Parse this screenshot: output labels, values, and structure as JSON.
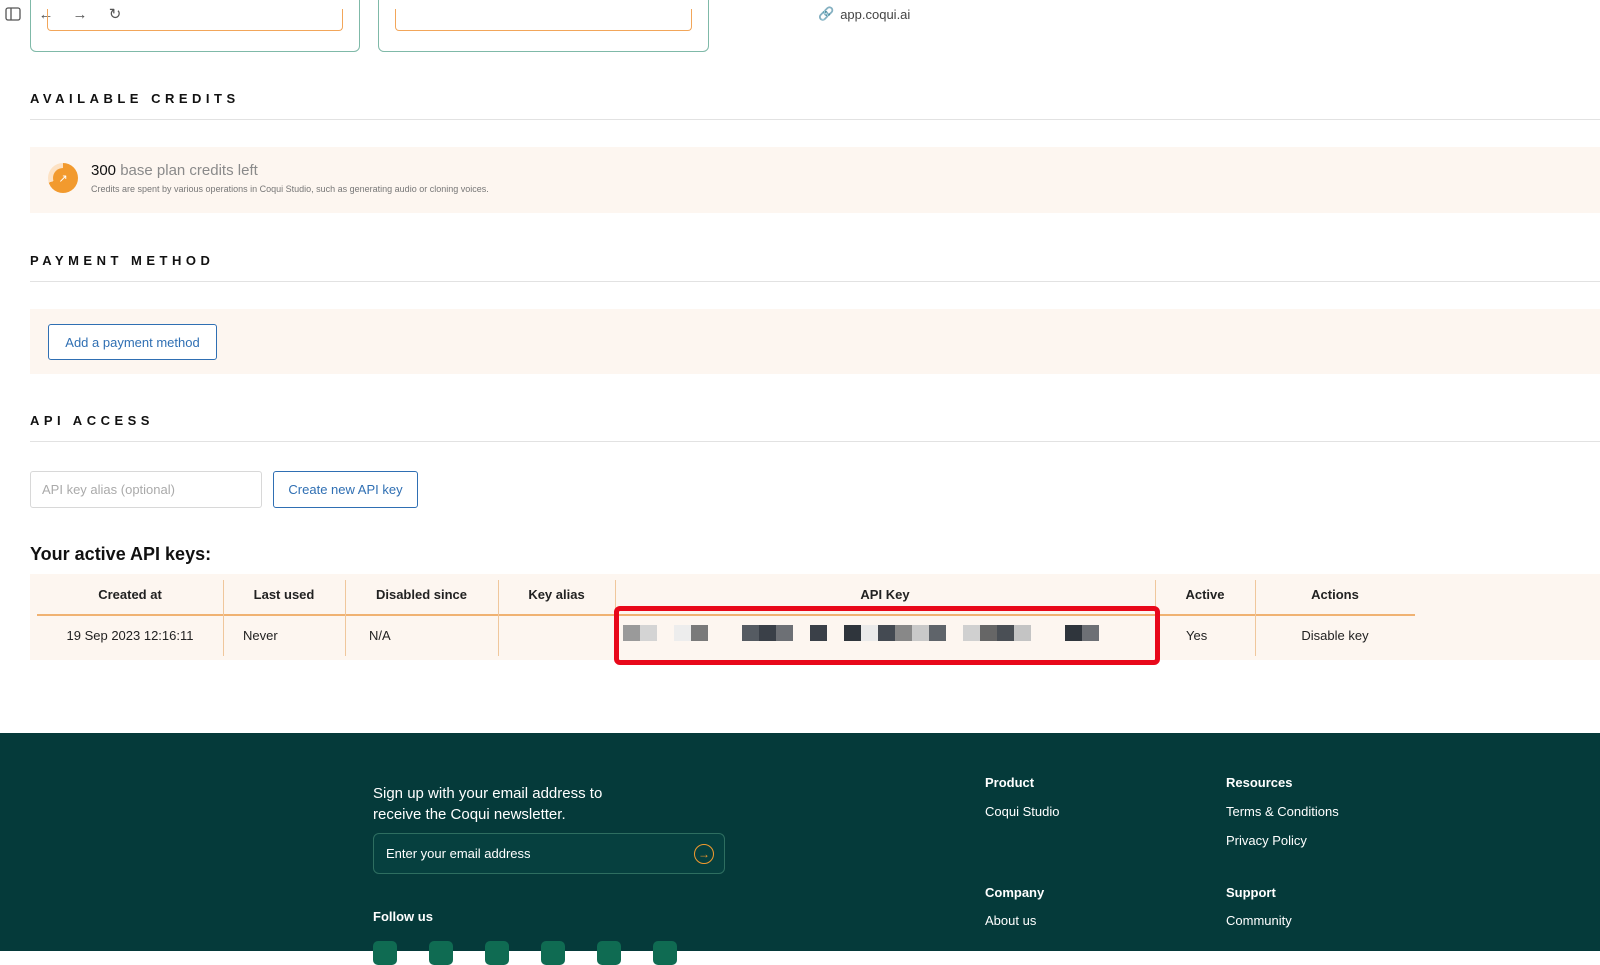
{
  "browser": {
    "url": "app.coqui.ai",
    "sidebar_icon": "sidebar-icon",
    "back_icon": "arrow-left-icon",
    "forward_icon": "arrow-right-icon",
    "reload_icon": "reload-icon",
    "link_icon": "link-icon"
  },
  "credits": {
    "section_title": "AVAILABLE CREDITS",
    "amount": "300",
    "label": " base plan credits left",
    "description": "Credits are spent by various operations in Coqui Studio, such as generating audio or cloning voices.",
    "ring_progress": 0.7
  },
  "payment": {
    "section_title": "PAYMENT METHOD",
    "add_button": "Add a payment method"
  },
  "api": {
    "section_title": "API ACCESS",
    "alias_placeholder": "API key alias (optional)",
    "create_button": "Create new API key",
    "keys_heading": "Your active API keys:",
    "columns": [
      "Created at",
      "Last used",
      "Disabled since",
      "Key alias",
      "API Key",
      "Active",
      "Actions"
    ],
    "rows": [
      {
        "created_at": "19 Sep 2023 12:16:11",
        "last_used": "Never",
        "disabled_since": "N/A",
        "key_alias": "",
        "api_key_redacted": true,
        "active": "Yes",
        "action": "Disable key"
      }
    ]
  },
  "colors": {
    "accent": "#f29a2e",
    "link_blue": "#2f6fb3",
    "danger": "#c2334a",
    "footer_bg": "#053a3a",
    "highlight_red": "#e8081a"
  },
  "footer": {
    "newsletter_text": "Sign up with your email address to receive the Coqui newsletter.",
    "email_placeholder": "Enter your email address",
    "follow_label": "Follow us",
    "socials": [
      "github-icon",
      "twitter-icon",
      "facebook-icon",
      "linkedin-icon",
      "discord-icon",
      "youtube-icon"
    ],
    "product_title": "Product",
    "product_links": [
      "Coqui Studio"
    ],
    "resources_title": "Resources",
    "resources_links": [
      "Terms & Conditions",
      "Privacy Policy"
    ],
    "company_title": "Company",
    "company_links": [
      "About us"
    ],
    "support_title": "Support",
    "support_links": [
      "Community"
    ]
  }
}
